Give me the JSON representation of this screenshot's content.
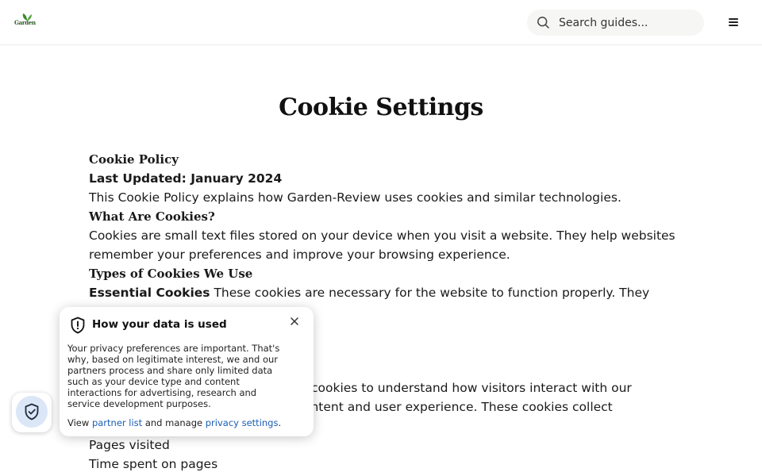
{
  "header": {
    "logo_text": "Garden",
    "search": {
      "placeholder": "Search guides...",
      "value": ""
    },
    "icons": {
      "search": "search-icon",
      "menu": "hamburger-menu-icon"
    }
  },
  "page": {
    "title": "Cookie Settings"
  },
  "content": {
    "policy_heading": "Cookie Policy",
    "last_updated": "Last Updated: January 2024",
    "intro": "This Cookie Policy explains how Garden-Review uses cookies and similar technologies.",
    "what_heading": "What Are Cookies?",
    "what_line1": "Cookies are small text files stored on your device when you visit a website. They help websites",
    "what_line2": "remember your preferences and improve your browsing experience.",
    "types_heading": "Types of Cookies We Use",
    "essential_label": "Essential Cookies",
    "essential_text": " These cookies are necessary for the website to function properly. They",
    "analytics_line1": "cookies to understand how visitors interact with our",
    "analytics_line2": "ontent and user experience. These cookies collect",
    "list_item1": "Pages visited",
    "list_item2": "Time spent on pages"
  },
  "privacy_popup": {
    "title": "How your data is used",
    "body": "Your privacy preferences are important. That's why, based on legitimate interest, we and our partners process and share only limited data such as your device type and content interactions for advertising, research and service development purposes.",
    "footer_prefix": "View ",
    "partner_link": "partner list",
    "footer_middle": " and manage ",
    "settings_link": "privacy settings",
    "footer_suffix": ".",
    "icons": {
      "shield": "shield-exclamation-icon",
      "close": "close-icon"
    }
  },
  "privacy_button": {
    "icon": "shield-check-icon"
  },
  "colors": {
    "link": "#1a5fb4",
    "logo_green": "#2d5a27",
    "search_bg": "#f6f7f4",
    "shield_bg": "#dbe6f7"
  }
}
